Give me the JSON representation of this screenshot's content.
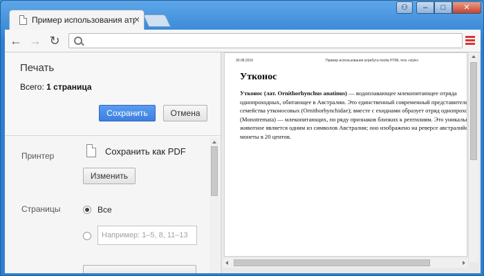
{
  "browser": {
    "tab_title": "Пример использования атрибута media HTML тега «style»",
    "tab_close": "×",
    "window_controls": {
      "minimize": "–",
      "maximize": "□",
      "close": "✕",
      "user": "⚇"
    },
    "icons": {
      "back": "arrow-left-icon",
      "forward": "arrow-right-icon",
      "reload": "reload-icon",
      "search": "search-icon",
      "menu": "menu-icon",
      "tab_page": "page-icon"
    },
    "nav": {
      "back": "←",
      "forward": "→",
      "reload": "↻"
    },
    "omnibox_value": ""
  },
  "print_panel": {
    "title": "Печать",
    "total_prefix": "Всего: ",
    "total_value": "1 страница",
    "save_label": "Сохранить",
    "cancel_label": "Отмена",
    "printer_label": "Принтер",
    "printer_name": "Сохранить как PDF",
    "change_label": "Изменить",
    "pages_label": "Страницы",
    "pages_option_all": "Все",
    "pages_range_placeholder": "Например: 1–5, 8, 11–13",
    "pages_selected": "all"
  },
  "preview": {
    "date": "30.08.2016",
    "header": "Пример использования атрибута media HTML тега «style»",
    "heading": "Утконос",
    "paragraph_bold": "Утконос (лат. Ornithorhynchus anatinus)",
    "lines": [
      " — водоплавающее млекопитающее отряда",
      "однопроходных, обитающее в Австралии. Это единственный современный представитель",
      "семейства утконосовых (Ornithorhynchidae); вместе с ехиднами образует отряд однопроходных",
      "(Monotremata) — млекопитающих, по ряду признаков близких к рептилиям. Это уникальное",
      "животное является одним из символов Австралии; оно изображено на реверсе австралийской",
      "монеты в 20 центов."
    ]
  },
  "colors": {
    "accent_button": "#4285f4",
    "window_frame": "#3a8fd8",
    "menu_icon": "#dd3333"
  }
}
